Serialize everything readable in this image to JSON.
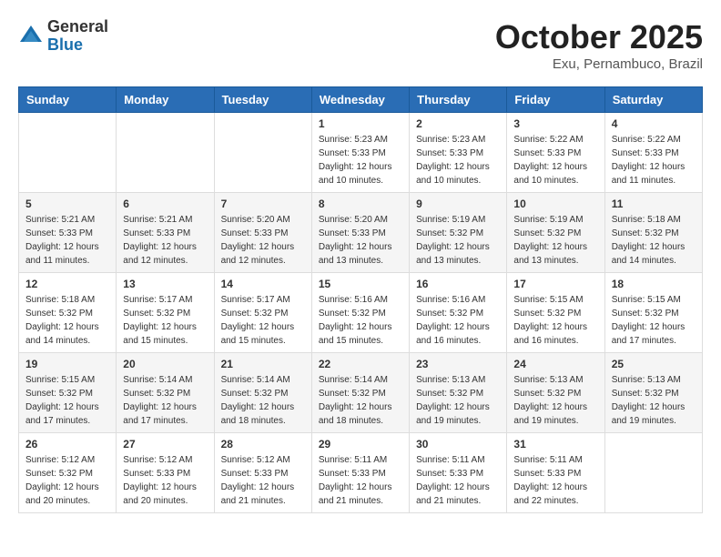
{
  "logo": {
    "general": "General",
    "blue": "Blue"
  },
  "header": {
    "month": "October 2025",
    "location": "Exu, Pernambuco, Brazil"
  },
  "weekdays": [
    "Sunday",
    "Monday",
    "Tuesday",
    "Wednesday",
    "Thursday",
    "Friday",
    "Saturday"
  ],
  "weeks": [
    [
      {
        "day": "",
        "info": ""
      },
      {
        "day": "",
        "info": ""
      },
      {
        "day": "",
        "info": ""
      },
      {
        "day": "1",
        "info": "Sunrise: 5:23 AM\nSunset: 5:33 PM\nDaylight: 12 hours\nand 10 minutes."
      },
      {
        "day": "2",
        "info": "Sunrise: 5:23 AM\nSunset: 5:33 PM\nDaylight: 12 hours\nand 10 minutes."
      },
      {
        "day": "3",
        "info": "Sunrise: 5:22 AM\nSunset: 5:33 PM\nDaylight: 12 hours\nand 10 minutes."
      },
      {
        "day": "4",
        "info": "Sunrise: 5:22 AM\nSunset: 5:33 PM\nDaylight: 12 hours\nand 11 minutes."
      }
    ],
    [
      {
        "day": "5",
        "info": "Sunrise: 5:21 AM\nSunset: 5:33 PM\nDaylight: 12 hours\nand 11 minutes."
      },
      {
        "day": "6",
        "info": "Sunrise: 5:21 AM\nSunset: 5:33 PM\nDaylight: 12 hours\nand 12 minutes."
      },
      {
        "day": "7",
        "info": "Sunrise: 5:20 AM\nSunset: 5:33 PM\nDaylight: 12 hours\nand 12 minutes."
      },
      {
        "day": "8",
        "info": "Sunrise: 5:20 AM\nSunset: 5:33 PM\nDaylight: 12 hours\nand 13 minutes."
      },
      {
        "day": "9",
        "info": "Sunrise: 5:19 AM\nSunset: 5:32 PM\nDaylight: 12 hours\nand 13 minutes."
      },
      {
        "day": "10",
        "info": "Sunrise: 5:19 AM\nSunset: 5:32 PM\nDaylight: 12 hours\nand 13 minutes."
      },
      {
        "day": "11",
        "info": "Sunrise: 5:18 AM\nSunset: 5:32 PM\nDaylight: 12 hours\nand 14 minutes."
      }
    ],
    [
      {
        "day": "12",
        "info": "Sunrise: 5:18 AM\nSunset: 5:32 PM\nDaylight: 12 hours\nand 14 minutes."
      },
      {
        "day": "13",
        "info": "Sunrise: 5:17 AM\nSunset: 5:32 PM\nDaylight: 12 hours\nand 15 minutes."
      },
      {
        "day": "14",
        "info": "Sunrise: 5:17 AM\nSunset: 5:32 PM\nDaylight: 12 hours\nand 15 minutes."
      },
      {
        "day": "15",
        "info": "Sunrise: 5:16 AM\nSunset: 5:32 PM\nDaylight: 12 hours\nand 15 minutes."
      },
      {
        "day": "16",
        "info": "Sunrise: 5:16 AM\nSunset: 5:32 PM\nDaylight: 12 hours\nand 16 minutes."
      },
      {
        "day": "17",
        "info": "Sunrise: 5:15 AM\nSunset: 5:32 PM\nDaylight: 12 hours\nand 16 minutes."
      },
      {
        "day": "18",
        "info": "Sunrise: 5:15 AM\nSunset: 5:32 PM\nDaylight: 12 hours\nand 17 minutes."
      }
    ],
    [
      {
        "day": "19",
        "info": "Sunrise: 5:15 AM\nSunset: 5:32 PM\nDaylight: 12 hours\nand 17 minutes."
      },
      {
        "day": "20",
        "info": "Sunrise: 5:14 AM\nSunset: 5:32 PM\nDaylight: 12 hours\nand 17 minutes."
      },
      {
        "day": "21",
        "info": "Sunrise: 5:14 AM\nSunset: 5:32 PM\nDaylight: 12 hours\nand 18 minutes."
      },
      {
        "day": "22",
        "info": "Sunrise: 5:14 AM\nSunset: 5:32 PM\nDaylight: 12 hours\nand 18 minutes."
      },
      {
        "day": "23",
        "info": "Sunrise: 5:13 AM\nSunset: 5:32 PM\nDaylight: 12 hours\nand 19 minutes."
      },
      {
        "day": "24",
        "info": "Sunrise: 5:13 AM\nSunset: 5:32 PM\nDaylight: 12 hours\nand 19 minutes."
      },
      {
        "day": "25",
        "info": "Sunrise: 5:13 AM\nSunset: 5:32 PM\nDaylight: 12 hours\nand 19 minutes."
      }
    ],
    [
      {
        "day": "26",
        "info": "Sunrise: 5:12 AM\nSunset: 5:32 PM\nDaylight: 12 hours\nand 20 minutes."
      },
      {
        "day": "27",
        "info": "Sunrise: 5:12 AM\nSunset: 5:33 PM\nDaylight: 12 hours\nand 20 minutes."
      },
      {
        "day": "28",
        "info": "Sunrise: 5:12 AM\nSunset: 5:33 PM\nDaylight: 12 hours\nand 21 minutes."
      },
      {
        "day": "29",
        "info": "Sunrise: 5:11 AM\nSunset: 5:33 PM\nDaylight: 12 hours\nand 21 minutes."
      },
      {
        "day": "30",
        "info": "Sunrise: 5:11 AM\nSunset: 5:33 PM\nDaylight: 12 hours\nand 21 minutes."
      },
      {
        "day": "31",
        "info": "Sunrise: 5:11 AM\nSunset: 5:33 PM\nDaylight: 12 hours\nand 22 minutes."
      },
      {
        "day": "",
        "info": ""
      }
    ]
  ]
}
